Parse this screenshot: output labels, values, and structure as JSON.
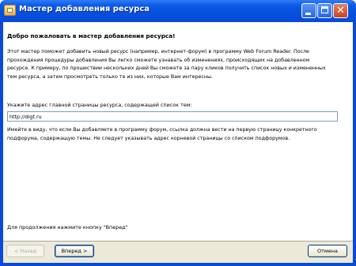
{
  "window": {
    "title": "Мастер добавления ресурса"
  },
  "content": {
    "heading": "Добро пожаловать в мастер добавления ресурса!",
    "intro": "Этот мастер поможет добавить новый ресурс (например, интернет-форум) в программу Web Forum Reader. После прохождения процедуры добавления Вы легко сможете узнавать об изменениях, происходящих на добавленном ресурсе. К примеру, по прошествии нескольких дней Вы сможете за пару кликов получить список новых и измененных тем ресурса, а затем   просмотреть только те из них, которые Вам интересны.",
    "url_label": "Укажите адрес главной страницы ресурса, содержащей список тем:",
    "url_value": "http://digt.ru",
    "hint": "Имейте в виду, что если Вы добавляете в программу форум, ссылка должна вести на первую страницу конкретного подфорума, содержащую темы. Не следует указывать адрес корневой страницы со списком подфорумов.",
    "continue_text": "Для продолжения нажмите кнопку \"Вперед\""
  },
  "buttons": {
    "back": "< Назад",
    "next": "Вперед >",
    "cancel": "Отмена"
  }
}
